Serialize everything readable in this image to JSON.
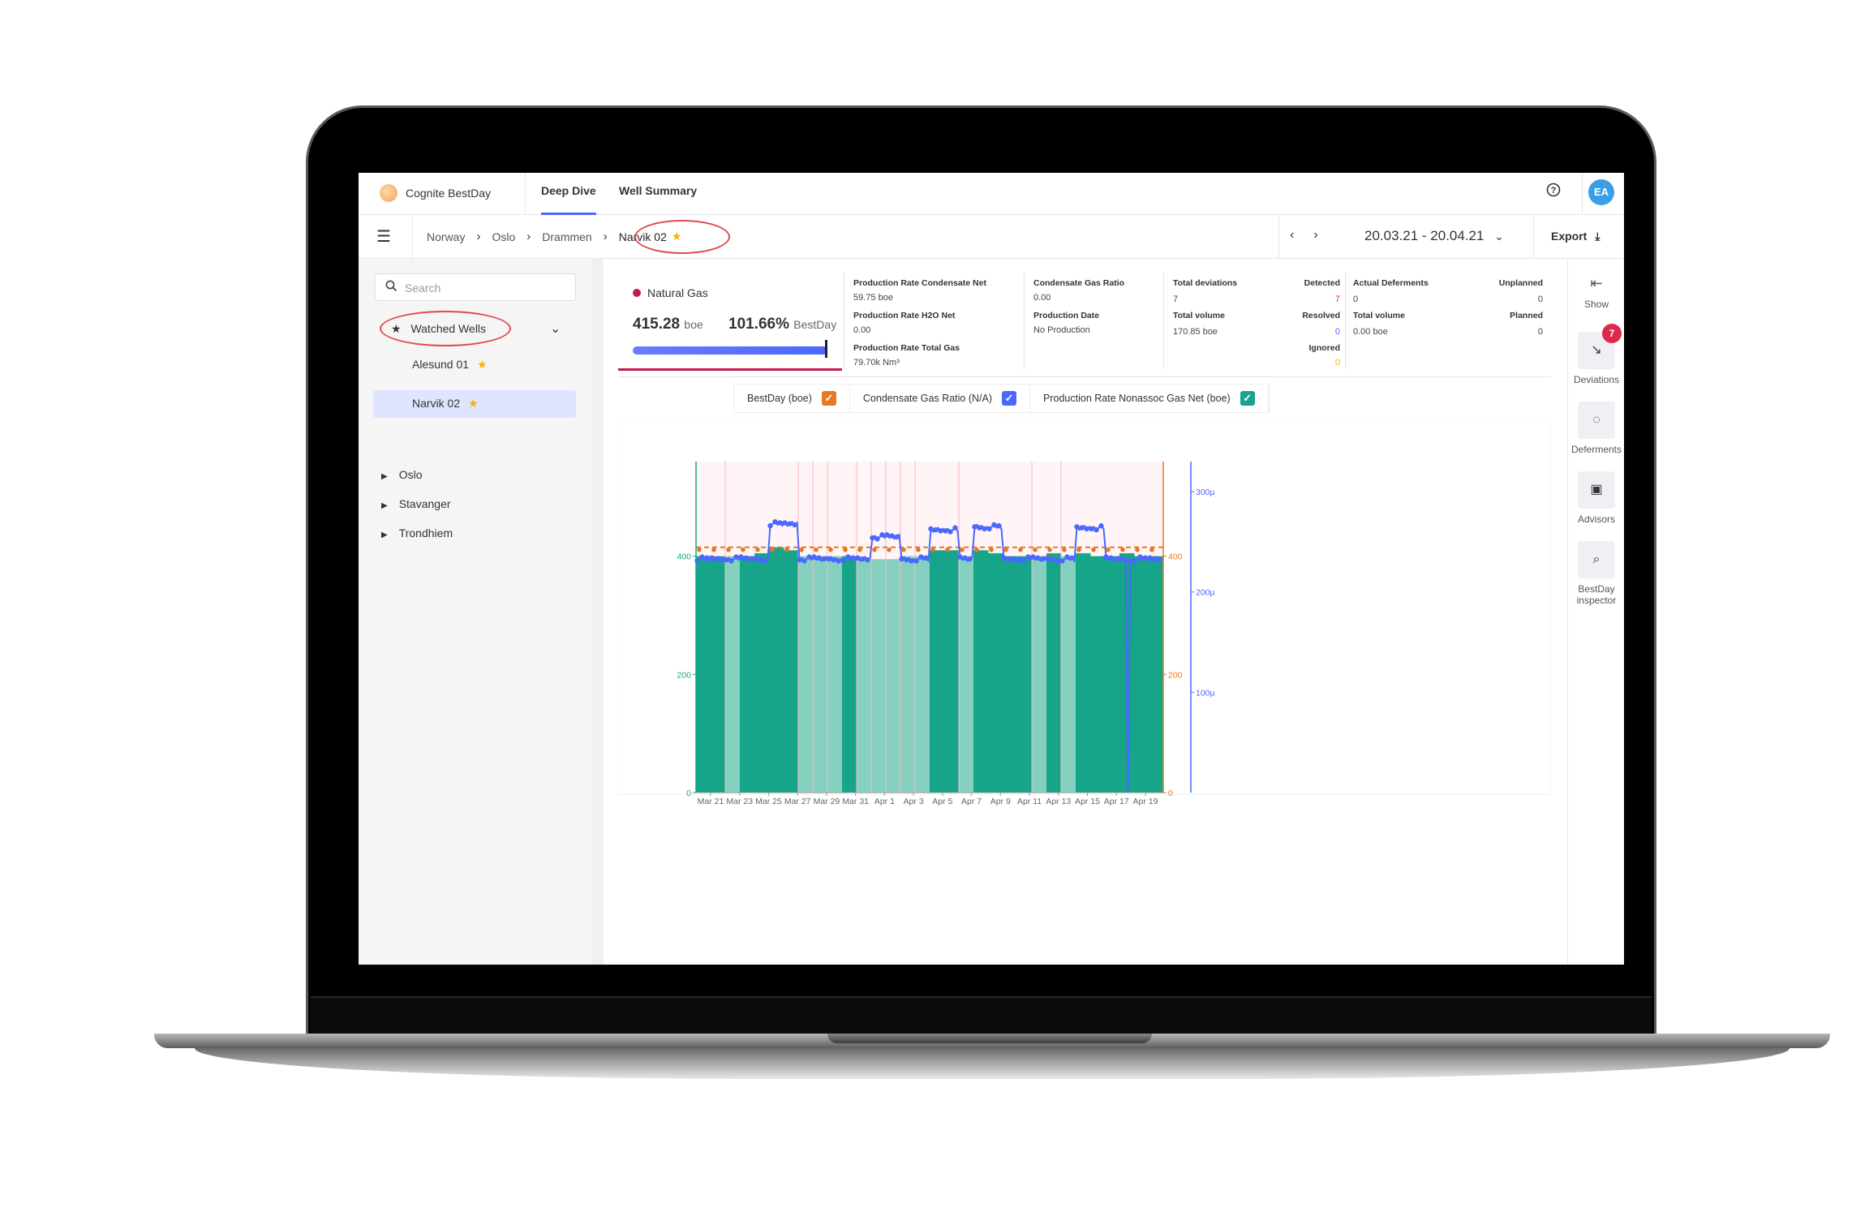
{
  "app": {
    "name": "Cognite BestDay",
    "tabs": [
      "Deep Dive",
      "Well Summary"
    ],
    "avatar": "EA",
    "help_icon": "?"
  },
  "breadcrumb": {
    "items": [
      "Norway",
      "Oslo",
      "Drammen"
    ],
    "current": "Narvik 02"
  },
  "date_range": "20.03.21 - 20.04.21",
  "export_label": "Export",
  "sidebar": {
    "search_placeholder": "Search",
    "watched_label": "Watched Wells",
    "wells": [
      "Alesund 01",
      "Narvik 02"
    ],
    "tree": [
      "Oslo",
      "Stavanger",
      "Trondhiem"
    ]
  },
  "summary": {
    "product": "Natural Gas",
    "value": "415.28",
    "value_unit": "boe",
    "pct": "101.66%",
    "pct_unit": "BestDay",
    "col1": [
      {
        "label": "Production Rate Condensate Net",
        "value": "59.75 boe"
      },
      {
        "label": "Production Rate H2O Net",
        "value": "0.00"
      },
      {
        "label": "Production Rate Total Gas",
        "value": "79.70k Nm³"
      }
    ],
    "col2": [
      {
        "label": "Condensate Gas Ratio",
        "value": "0.00"
      },
      {
        "label": "Production Date",
        "value": "No Production"
      }
    ],
    "deviations": {
      "title": "Total deviations",
      "total": "7",
      "detected_label": "Detected",
      "detected": "7",
      "volume_label": "Total volume",
      "volume": "170.85 boe",
      "resolved_label": "Resolved",
      "resolved": "0",
      "ignored_label": "Ignored",
      "ignored": "0"
    },
    "deferments": {
      "title": "Actual Deferments",
      "total": "0",
      "unplanned_label": "Unplanned",
      "unplanned": "0",
      "volume_label": "Total volume",
      "volume": "0.00 boe",
      "planned_label": "Planned",
      "planned": "0"
    }
  },
  "legend": [
    {
      "label": "BestDay (boe)",
      "color": "#e87722"
    },
    {
      "label": "Condensate Gas Ratio (N/A)",
      "color": "#4a67ff"
    },
    {
      "label": "Production Rate Nonassoc Gas Net (boe)",
      "color": "#17a589"
    }
  ],
  "rightbar": [
    {
      "label": "Show",
      "icon": "collapse-left-icon"
    },
    {
      "label": "Deviations",
      "icon": "deviation-icon",
      "badge": "7"
    },
    {
      "label": "Deferments",
      "icon": "deferment-icon"
    },
    {
      "label": "Advisors",
      "icon": "advisor-icon"
    },
    {
      "label": "BestDay inspector",
      "icon": "inspector-icon"
    }
  ],
  "chart_data": {
    "type": "bar",
    "x_ticks": [
      "Mar 21",
      "Mar 23",
      "Mar 25",
      "Mar 27",
      "Mar 29",
      "Mar 31",
      "Apr 1",
      "Apr 3",
      "Apr 5",
      "Apr 7",
      "Apr 9",
      "Apr 11",
      "Apr 13",
      "Apr 15",
      "Apr 17",
      "Apr 19"
    ],
    "y_left": {
      "ticks": [
        "0",
        "200",
        "400"
      ],
      "range": [
        0,
        560
      ],
      "color": "#17a589"
    },
    "y_right_orange": {
      "ticks": [
        "0",
        "200",
        "400"
      ],
      "range": [
        0,
        560
      ],
      "color": "#e87722"
    },
    "y_right_blue": {
      "ticks": [
        "100µ",
        "200µ",
        "300µ"
      ],
      "range": [
        0,
        330
      ],
      "color": "#4a67ff"
    },
    "bars": [
      {
        "value": 400,
        "light": false
      },
      {
        "value": 400,
        "light": false
      },
      {
        "value": 400,
        "light": true
      },
      {
        "value": 400,
        "light": false
      },
      {
        "value": 405,
        "light": false
      },
      {
        "value": 415,
        "light": false
      },
      {
        "value": 410,
        "light": false
      },
      {
        "value": 400,
        "light": true
      },
      {
        "value": 400,
        "light": true
      },
      {
        "value": 400,
        "light": true
      },
      {
        "value": 400,
        "light": false
      },
      {
        "value": 395,
        "light": true
      },
      {
        "value": 395,
        "light": true
      },
      {
        "value": 395,
        "light": true
      },
      {
        "value": 400,
        "light": true
      },
      {
        "value": 400,
        "light": true
      },
      {
        "value": 410,
        "light": false
      },
      {
        "value": 410,
        "light": false
      },
      {
        "value": 400,
        "light": true
      },
      {
        "value": 410,
        "light": false
      },
      {
        "value": 405,
        "light": false
      },
      {
        "value": 400,
        "light": false
      },
      {
        "value": 400,
        "light": false
      },
      {
        "value": 400,
        "light": true
      },
      {
        "value": 405,
        "light": false
      },
      {
        "value": 400,
        "light": true
      },
      {
        "value": 405,
        "light": false
      },
      {
        "value": 400,
        "light": false
      },
      {
        "value": 400,
        "light": false
      },
      {
        "value": 405,
        "light": false
      },
      {
        "value": 400,
        "light": false
      },
      {
        "value": 400,
        "light": false
      }
    ],
    "bestday_value": 415,
    "ratio_spikes": [
      {
        "start": 5,
        "end": 6,
        "value": 268
      },
      {
        "start": 12,
        "end": 13,
        "value": 255
      },
      {
        "start": 16,
        "end": 17,
        "value": 262
      },
      {
        "start": 19,
        "end": 20,
        "value": 265
      },
      {
        "start": 26,
        "end": 27,
        "value": 264
      }
    ],
    "ratio_baseline": 233,
    "ratio_dip": {
      "index": 29,
      "value": 0
    }
  }
}
